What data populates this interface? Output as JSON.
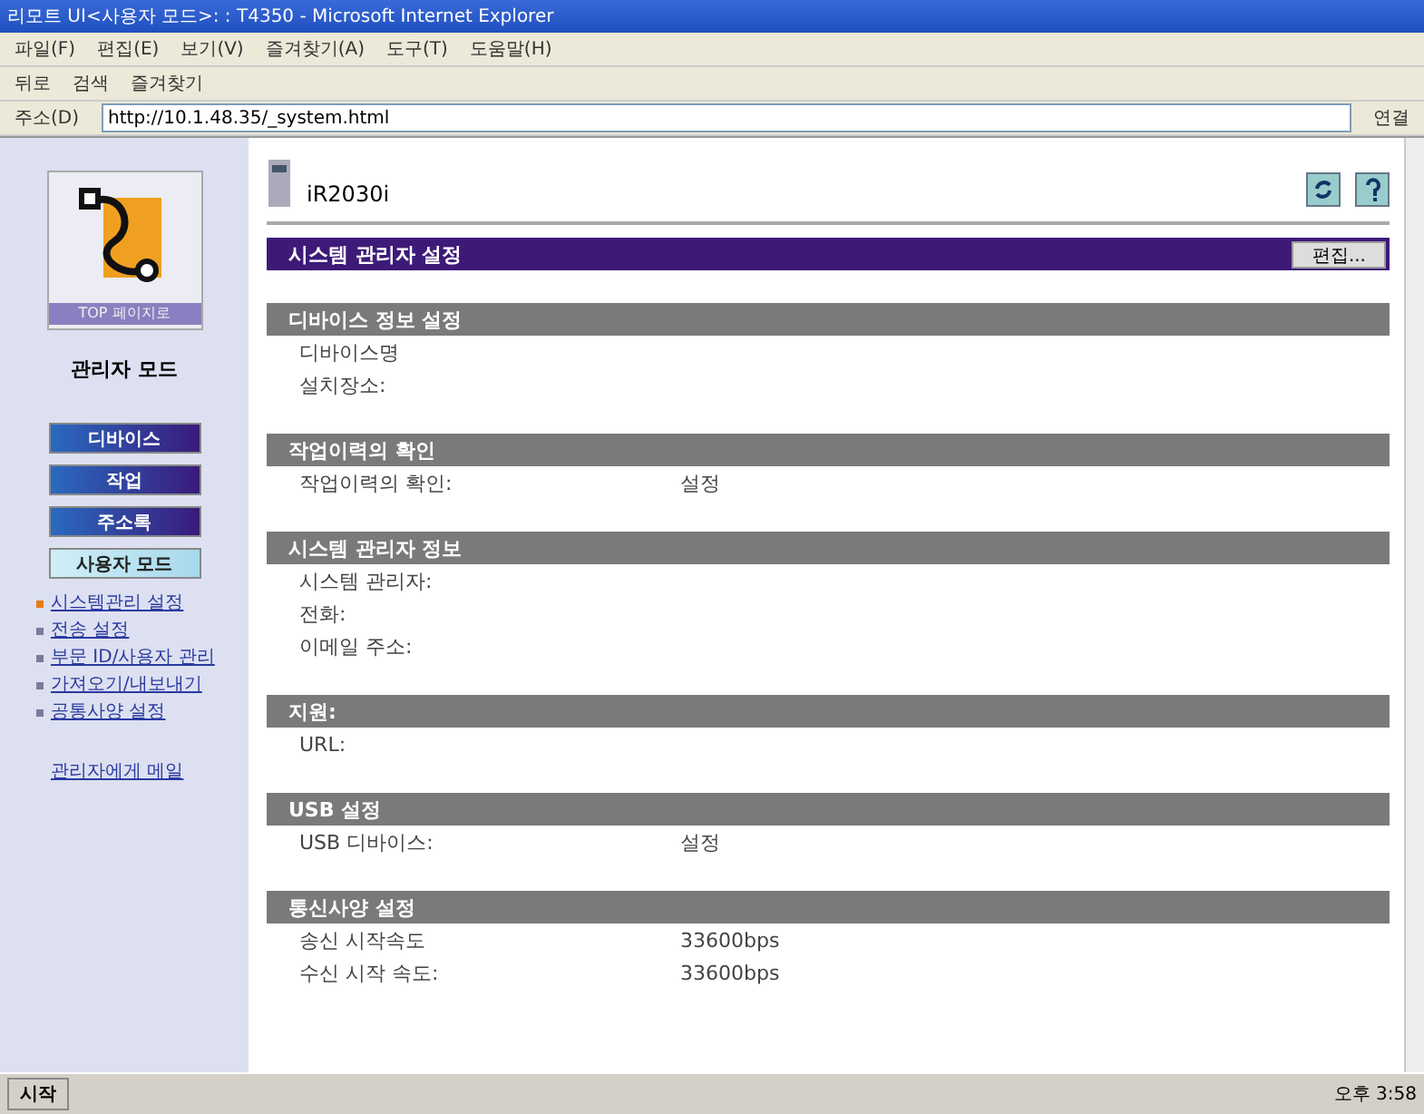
{
  "window": {
    "title": "리모트 UI<사용자 모드>: : T4350 - Microsoft Internet Explorer"
  },
  "menu": [
    "파일(F)",
    "편집(E)",
    "보기(V)",
    "즐겨찾기(A)",
    "도구(T)",
    "도움말(H)"
  ],
  "toolbar": {
    "back": "뒤로",
    "search": "검색",
    "favorites": "즐겨찾기"
  },
  "address": {
    "label": "주소(D)",
    "value": "http://10.1.48.35/_system.html",
    "links": "연결"
  },
  "sidebar": {
    "logo_caption": "TOP 페이지로",
    "mode": "관리자 모드",
    "buttons": [
      {
        "label": "디바이스",
        "selected": false
      },
      {
        "label": "작업",
        "selected": false
      },
      {
        "label": "주소록",
        "selected": false
      },
      {
        "label": "사용자 모드",
        "selected": true
      }
    ],
    "links": [
      {
        "label": "시스템관리 설정",
        "selected": true
      },
      {
        "label": "전송 설정",
        "selected": false
      },
      {
        "label": "부문 ID/사용자 관리",
        "selected": false
      },
      {
        "label": "가져오기/내보내기",
        "selected": false
      },
      {
        "label": "공통사양 설정",
        "selected": false
      }
    ],
    "mail_link": "관리자에게 메일"
  },
  "device": {
    "name": "iR2030i"
  },
  "page": {
    "title": "시스템 관리자 설정",
    "edit_button": "편집..."
  },
  "sections": [
    {
      "title": "디바이스 정보 설정",
      "rows": [
        {
          "label": "디바이스명"
        },
        {
          "label": "설치장소:"
        }
      ]
    },
    {
      "title": "작업이력의 확인",
      "rows": [
        {
          "label": "작업이력의 확인:",
          "value": "설정"
        }
      ]
    },
    {
      "title": "시스템 관리자 정보",
      "rows": [
        {
          "label": "시스템 관리자:"
        },
        {
          "label": "전화:"
        },
        {
          "label": "이메일 주소:"
        }
      ]
    },
    {
      "title": "지원:",
      "rows": [
        {
          "label": "URL:"
        }
      ]
    },
    {
      "title": "USB 설정",
      "rows": [
        {
          "label": "USB 디바이스:",
          "value": "설정"
        }
      ]
    },
    {
      "title": "통신사양 설정",
      "rows": [
        {
          "label": "송신 시작속도",
          "value": "33600bps"
        },
        {
          "label": "수신 시작 속도:",
          "value": "33600bps"
        }
      ]
    }
  ],
  "taskbar": {
    "start": "시작",
    "clock": "오후 3:58"
  }
}
